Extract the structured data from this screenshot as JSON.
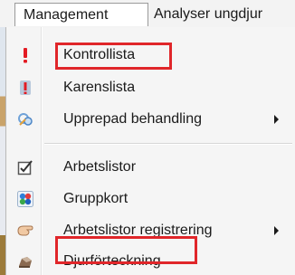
{
  "menubar": {
    "management": "Management",
    "analyser": "Analyser ungdjur"
  },
  "menu": {
    "items": [
      {
        "label": "Kontrollista",
        "icon": "exclamation-icon",
        "submenu": false
      },
      {
        "label": "Karenslista",
        "icon": "info-icon",
        "submenu": false
      },
      {
        "label": "Upprepad behandling",
        "icon": "repeat-treatment-icon",
        "submenu": true
      },
      {
        "label": "Arbetslistor",
        "icon": "checkbox-pencil-icon",
        "submenu": false
      },
      {
        "label": "Gruppkort",
        "icon": "colored-dots-icon",
        "submenu": false
      },
      {
        "label": "Arbetslistor registrering",
        "icon": "hand-register-icon",
        "submenu": true
      },
      {
        "label": "Djurförteckning",
        "icon": "animal-list-icon",
        "submenu": false
      }
    ]
  },
  "highlight_color": "#e0262a"
}
